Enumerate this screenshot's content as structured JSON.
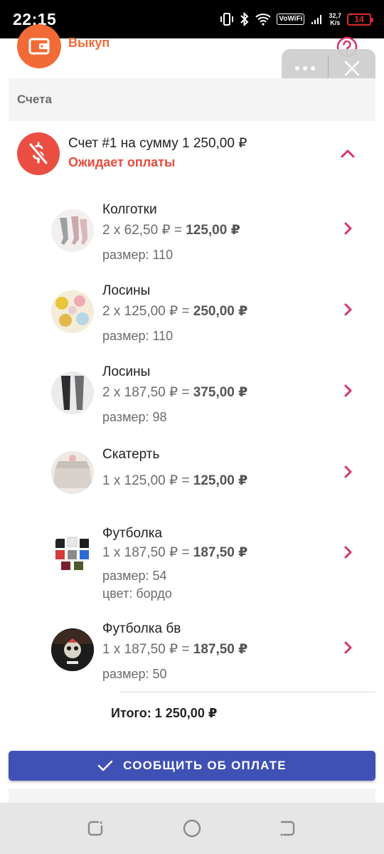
{
  "status_bar": {
    "time": "22:15",
    "vowifi": "VoWiFi",
    "speed_value": "32,7",
    "speed_unit": "K/s",
    "battery": "14",
    "battery_color": "#e0282e"
  },
  "top_section": {
    "label": "Выкуп",
    "icon": "wallet-icon",
    "accent": "#f26b37"
  },
  "section_header": {
    "title": "Счета"
  },
  "invoice": {
    "title": "Счет #1 на сумму 1 250,00 ₽",
    "status": "Ожидает оплаты",
    "status_color": "#e64a3e",
    "icon": "no-money-icon"
  },
  "items": [
    {
      "name": "Колготки",
      "qty_price": "2 x 62,50 ₽ = ",
      "sum": "125,00 ₽",
      "attrs": [
        "размер: 110"
      ]
    },
    {
      "name": "Лосины",
      "qty_price": "2 x 125,00 ₽ = ",
      "sum": "250,00 ₽",
      "attrs": [
        "размер: 110"
      ]
    },
    {
      "name": "Лосины",
      "qty_price": "2 x 187,50 ₽ = ",
      "sum": "375,00 ₽",
      "attrs": [
        "размер: 98"
      ]
    },
    {
      "name": "Скатерть",
      "qty_price": "1 x 125,00 ₽ = ",
      "sum": "125,00 ₽",
      "attrs": []
    },
    {
      "name": "Футболка",
      "qty_price": "1 x 187,50 ₽ = ",
      "sum": "187,50 ₽",
      "attrs": [
        "размер: 54",
        "цвет: бордо"
      ]
    },
    {
      "name": "Футболка бв",
      "qty_price": "1 x 187,50 ₽ = ",
      "sum": "187,50 ₽",
      "attrs": [
        "размер: 50"
      ]
    }
  ],
  "total": "Итого: 1 250,00 ₽",
  "report_button": {
    "label": "СООБЩИТЬ ОБ ОПЛАТЕ",
    "color": "#3f51b5"
  },
  "chevron_color": "#d6336c"
}
